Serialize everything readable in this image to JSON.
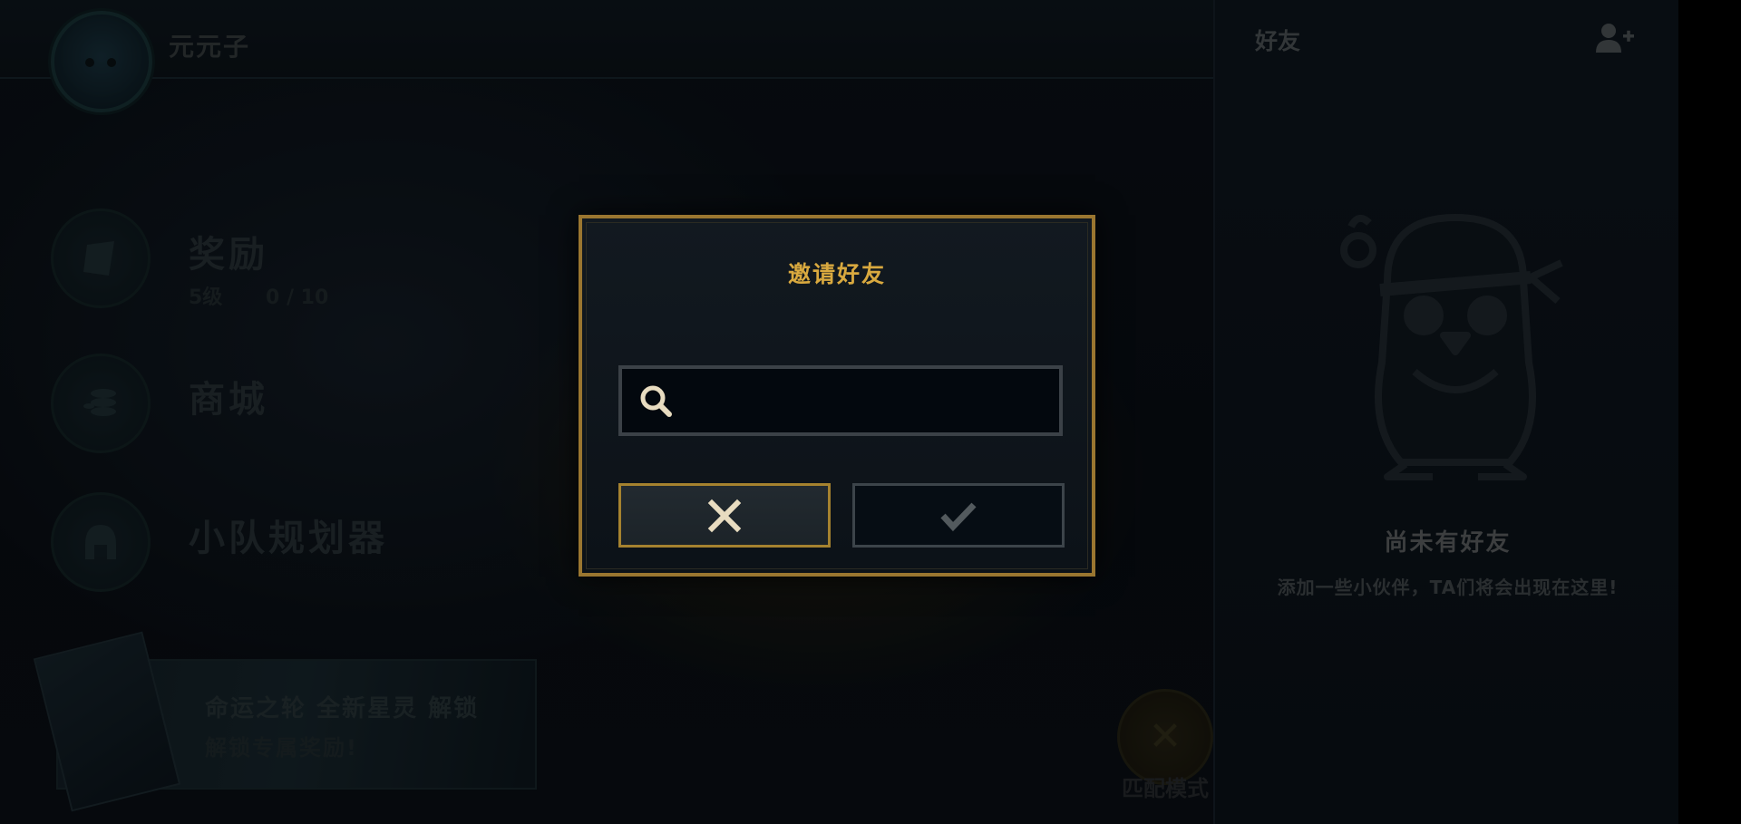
{
  "profile": {
    "name": "元元子"
  },
  "menu": {
    "rewards": {
      "label": "奖励",
      "level": "5级",
      "progress": "0 / 10"
    },
    "shop": {
      "label": "商城"
    },
    "squad": {
      "label": "小队规划器"
    }
  },
  "promo": {
    "line1": "命运之轮 全新星灵 解锁",
    "line2": "解锁专属奖励!"
  },
  "match_mode": {
    "label": "匹配模式"
  },
  "friends": {
    "title": "好友",
    "empty_title": "尚未有好友",
    "empty_subtitle": "添加一些小伙伴，TA们将会出现在这里!"
  },
  "dialog": {
    "title": "邀请好友",
    "search_value": "",
    "search_placeholder": ""
  },
  "colors": {
    "gold_border": "#9a7630",
    "title_gold": "#d9a93f",
    "icon_cream": "#e8dcc0"
  },
  "icons": {
    "search": "search-icon",
    "cancel": "close-icon",
    "confirm": "check-icon",
    "add_friend": "add-user-icon"
  }
}
